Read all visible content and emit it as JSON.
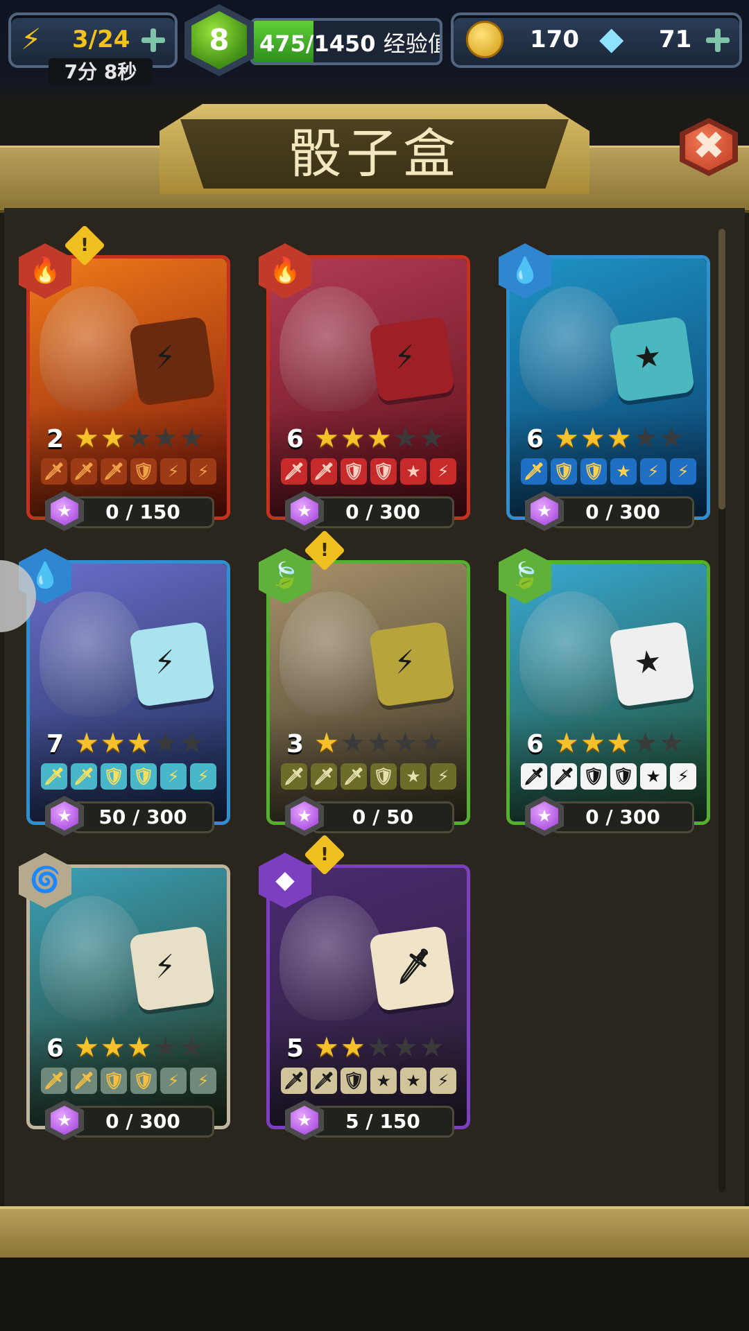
{
  "topbar": {
    "energy": "3/24",
    "timer": "7分 8秒",
    "level": "8",
    "xp_text": "475/1450",
    "xp_label": "经验值",
    "xp_fraction": 0.3276,
    "gold": "170",
    "gems": "71"
  },
  "panel": {
    "title": "骰子盒",
    "close_icon": "✖"
  },
  "cards": [
    {
      "element": "fire",
      "element_icon": "🔥",
      "frame": "#c4311f",
      "bg1": "#f07a1a",
      "bg2": "#7a140a",
      "die": "#6a2a10",
      "die_face": "⚡",
      "level": "2",
      "stars": 2,
      "faces": [
        "🗡",
        "🗡",
        "🗡",
        "🛡",
        "⚡",
        "⚡"
      ],
      "face_bg": "#9c3b15",
      "face_fg": "#f0a24a",
      "progress": "0 / 150",
      "alert": true
    },
    {
      "element": "fire",
      "element_icon": "🔥",
      "frame": "#c4311f",
      "bg1": "#b23b55",
      "bg2": "#5a0f18",
      "die": "#9e1f25",
      "die_face": "⚡",
      "level": "6",
      "stars": 3,
      "faces": [
        "🗡",
        "🗡",
        "🛡",
        "🛡",
        "★",
        "⚡"
      ],
      "face_bg": "#c72a2a",
      "face_fg": "#ffd0c0",
      "progress": "0 / 300",
      "alert": false
    },
    {
      "element": "water",
      "element_icon": "💧",
      "frame": "#2f8fcf",
      "bg1": "#1e94c5",
      "bg2": "#0a3c6a",
      "die": "#4bb8c0",
      "die_face": "★",
      "level": "6",
      "stars": 3,
      "faces": [
        "🗡",
        "🛡",
        "🛡",
        "★",
        "⚡",
        "⚡"
      ],
      "face_bg": "#1f6fc4",
      "face_fg": "#ffd050",
      "progress": "0 / 300",
      "alert": false
    },
    {
      "element": "water",
      "element_icon": "💧",
      "frame": "#2f8fcf",
      "bg1": "#6a6ec9",
      "bg2": "#1a2b52",
      "die": "#a9e3ee",
      "die_face": "⚡",
      "level": "7",
      "stars": 3,
      "faces": [
        "🗡",
        "🗡",
        "🛡",
        "🛡",
        "⚡",
        "⚡"
      ],
      "face_bg": "#48b7c9",
      "face_fg": "#f5e060",
      "progress": "50 / 300",
      "alert": false
    },
    {
      "element": "nature",
      "element_icon": "🍃",
      "frame": "#56b030",
      "bg1": "#a7916a",
      "bg2": "#3a3424",
      "die": "#b7a53c",
      "die_face": "⚡",
      "level": "3",
      "stars": 1,
      "faces": [
        "🗡",
        "🗡",
        "🗡",
        "🛡",
        "★",
        "⚡"
      ],
      "face_bg": "#6d6d2a",
      "face_fg": "#e6e0b0",
      "progress": "0 / 50",
      "alert": true
    },
    {
      "element": "nature",
      "element_icon": "🍃",
      "frame": "#56b030",
      "bg1": "#39a8d2",
      "bg2": "#1f4a2a",
      "die": "#efefef",
      "die_face": "★",
      "level": "6",
      "stars": 3,
      "faces": [
        "🗡",
        "🗡",
        "🛡",
        "🛡",
        "★",
        "⚡"
      ],
      "face_bg": "#f4f4f4",
      "face_fg": "#111111",
      "progress": "0 / 300",
      "alert": false
    },
    {
      "element": "wind",
      "element_icon": "🌀",
      "frame": "#bfb6a0",
      "bg1": "#3ba1b8",
      "bg2": "#24341c",
      "die": "#e7dfc6",
      "die_face": "⚡",
      "level": "6",
      "stars": 3,
      "faces": [
        "🗡",
        "🗡",
        "🛡",
        "🛡",
        "⚡",
        "⚡"
      ],
      "face_bg": "#6f8a7c",
      "face_fg": "#f5c040",
      "progress": "0 / 300",
      "alert": false
    },
    {
      "element": "void",
      "element_icon": "◆",
      "frame": "#7b3fc0",
      "bg1": "#4a2a72",
      "bg2": "#2a2032",
      "die": "#efe4c8",
      "die_face": "🗡",
      "level": "5",
      "stars": 2,
      "faces": [
        "🗡",
        "🗡",
        "🛡",
        "★",
        "★",
        "⚡"
      ],
      "face_bg": "#d1c39a",
      "face_fg": "#1a1a1a",
      "progress": "5 / 150",
      "alert": true
    }
  ],
  "colors": {
    "accent_green": "#5fcf35",
    "gold": "#f6c12a",
    "gem": "#9b3ad8"
  }
}
